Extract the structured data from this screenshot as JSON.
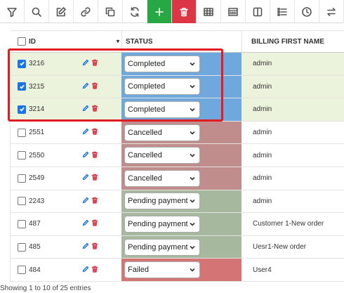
{
  "toolbar": {
    "buttons": [
      {
        "icon": "filter-icon"
      },
      {
        "icon": "search-icon"
      },
      {
        "icon": "edit-icon"
      },
      {
        "icon": "link-icon"
      },
      {
        "icon": "copy-icon"
      },
      {
        "icon": "refresh-icon"
      },
      {
        "icon": "plus-icon",
        "color": "#27a844"
      },
      {
        "icon": "trash-icon",
        "color": "#dc3545"
      },
      {
        "icon": "table-icon"
      },
      {
        "icon": "grid-dots-icon"
      },
      {
        "icon": "columns-icon"
      },
      {
        "icon": "list-icon"
      },
      {
        "icon": "clock-icon"
      },
      {
        "icon": "swap-icon"
      }
    ]
  },
  "table": {
    "headers": {
      "id": "ID",
      "status": "STATUS",
      "billing_first_name": "BILLING FIRST NAME"
    },
    "rows": [
      {
        "id": "3216",
        "checked": true,
        "status": "Completed",
        "status_color": "#6fa8dc",
        "name": "admin"
      },
      {
        "id": "3215",
        "checked": true,
        "status": "Completed",
        "status_color": "#6fa8dc",
        "name": "admin"
      },
      {
        "id": "3214",
        "checked": true,
        "status": "Completed",
        "status_color": "#6fa8dc",
        "name": "admin"
      },
      {
        "id": "2551",
        "checked": false,
        "status": "Cancelled",
        "status_color": "#c08c8c",
        "name": "admin"
      },
      {
        "id": "2550",
        "checked": false,
        "status": "Cancelled",
        "status_color": "#c08c8c",
        "name": "admin"
      },
      {
        "id": "2549",
        "checked": false,
        "status": "Cancelled",
        "status_color": "#c08c8c",
        "name": "admin"
      },
      {
        "id": "2243",
        "checked": false,
        "status": "Pending payment",
        "status_color": "#a6b99f",
        "name": "admin"
      },
      {
        "id": "487",
        "checked": false,
        "status": "Pending payment",
        "status_color": "#a6b99f",
        "name": "Customer 1-New order"
      },
      {
        "id": "485",
        "checked": false,
        "status": "Pending payment",
        "status_color": "#a6b99f",
        "name": "Uesr1-New order"
      },
      {
        "id": "484",
        "checked": false,
        "status": "Failed",
        "status_color": "#d47474",
        "name": "User4"
      }
    ]
  },
  "footer": {
    "info": "Showing 1 to 10 of 25 entries"
  },
  "colors": {
    "selected_row": "#ecf3dc",
    "highlight": "#e11b22",
    "checkbox": "#1a73e8"
  }
}
